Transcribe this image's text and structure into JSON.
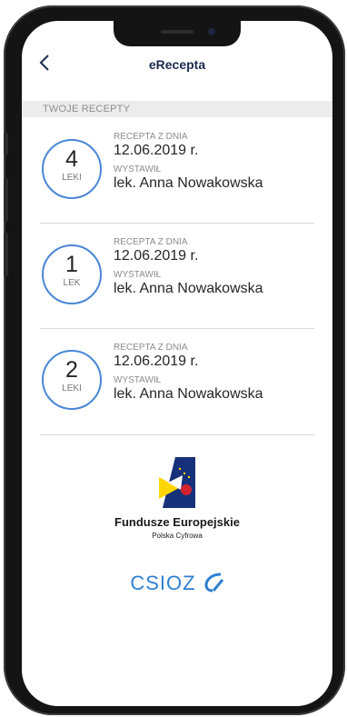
{
  "app": {
    "title": "eRecepta"
  },
  "section": {
    "label": "TWOJE RECEPTY"
  },
  "prescriptions": [
    {
      "count": "4",
      "unit": "LEKI",
      "date_label": "RECEPTA Z DNIA",
      "date": "12.06.2019 r.",
      "issuer_label": "WYSTAWIŁ",
      "issuer": "lek. Anna Nowakowska"
    },
    {
      "count": "1",
      "unit": "LEK",
      "date_label": "RECEPTA Z DNIA",
      "date": "12.06.2019 r.",
      "issuer_label": "WYSTAWIŁ",
      "issuer": "lek. Anna Nowakowska"
    },
    {
      "count": "2",
      "unit": "LEKI",
      "date_label": "RECEPTA Z DNIA",
      "date": "12.06.2019 r.",
      "issuer_label": "WYSTAWIŁ",
      "issuer": "lek. Anna Nowakowska"
    }
  ],
  "footer": {
    "eu_title": "Fundusze Europejskie",
    "eu_subtitle": "Polska Cyfrowa",
    "csioz_logo": "CSIOZ"
  },
  "colors": {
    "accent": "#4a86d6",
    "title": "#1b2a4e",
    "csioz": "#2f7fd0"
  }
}
